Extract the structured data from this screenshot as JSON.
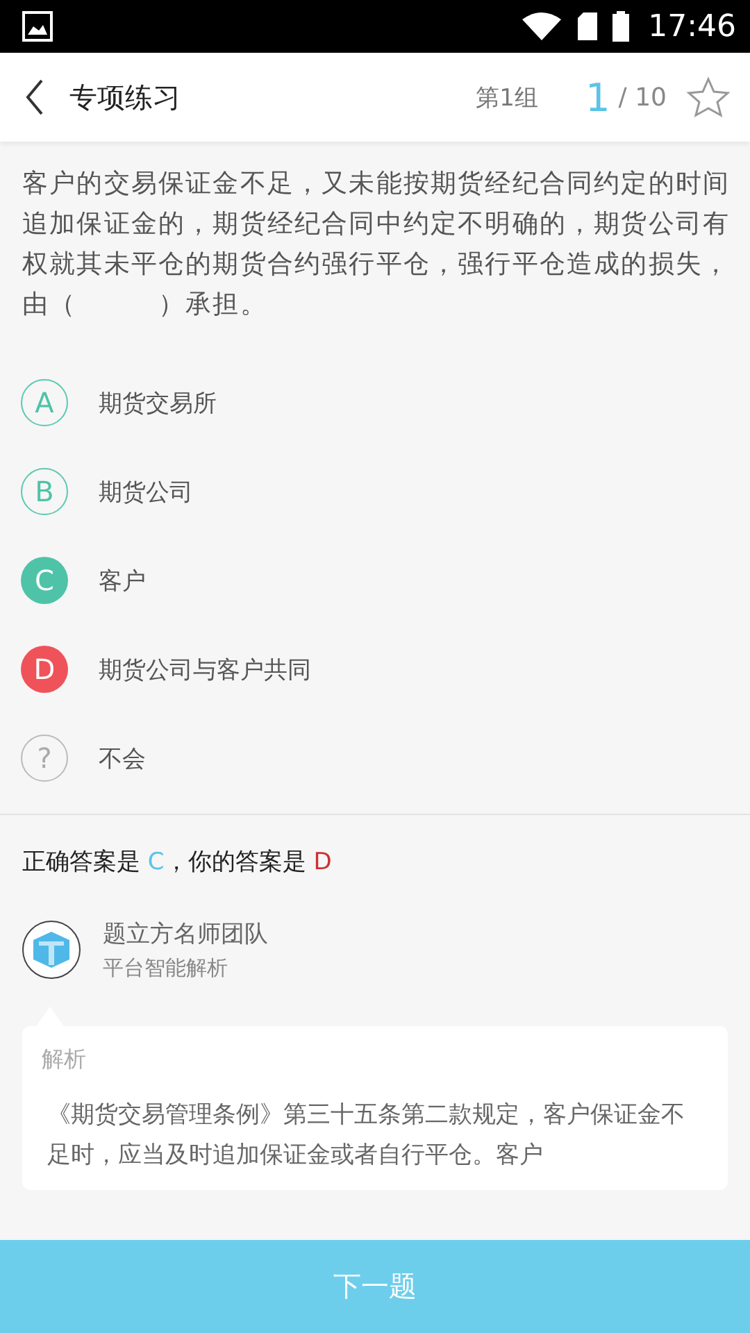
{
  "status_bar": {
    "time": "17:46"
  },
  "header": {
    "title": "专项练习",
    "group": "第1组",
    "current": "1",
    "total": "/ 10",
    "starred": false
  },
  "question": "客户的交易保证金不足，又未能按期货经纪合同约定的时间追加保证金的，期货经纪合同中约定不明确的，期货公司有权就其未平仓的期货合约强行平仓，强行平仓造成的损失，由（　　　）承担。",
  "options": [
    {
      "kind": "letter",
      "letter": "A",
      "text": "期货交易所",
      "correct": false,
      "picked": false
    },
    {
      "kind": "letter",
      "letter": "B",
      "text": "期货公司",
      "correct": false,
      "picked": false
    },
    {
      "kind": "letter",
      "letter": "C",
      "text": "客户",
      "correct": true,
      "picked": false
    },
    {
      "kind": "letter",
      "letter": "D",
      "text": "期货公司与客户共同",
      "correct": false,
      "picked": true
    },
    {
      "kind": "unknown",
      "letter": "?",
      "text": "不会",
      "correct": false,
      "picked": false
    }
  ],
  "result": {
    "correct_label": "正确答案是",
    "correct": "C",
    "separator": "，你的答案是",
    "yours": "D"
  },
  "author": {
    "name": "题立方名师团队",
    "subtitle": "平台智能解析"
  },
  "analysis": {
    "title": "解析",
    "text": "《期货交易管理条例》第三十五条第二款规定，客户保证金不足时，应当及时追加保证金或者自行平仓。客户"
  },
  "next_button": "下一题"
}
